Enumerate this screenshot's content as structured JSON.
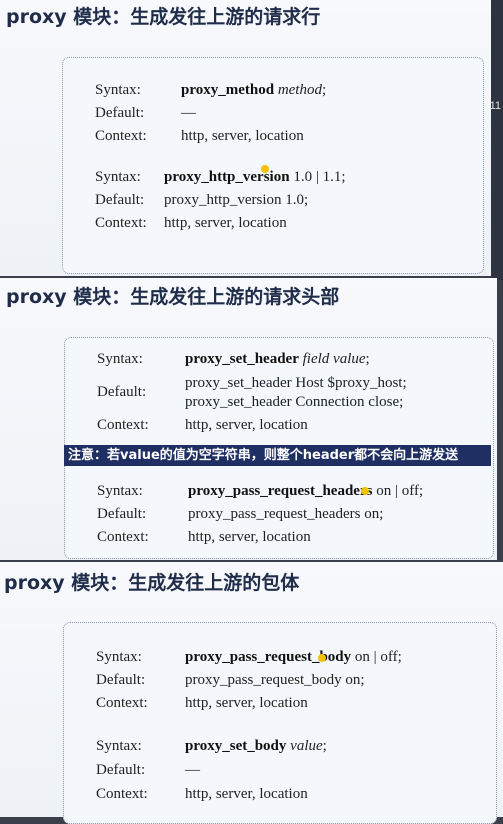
{
  "panel1": {
    "title": "proxy 模块：生成发往上游的请求行",
    "b1": {
      "syntax_label": "Syntax:",
      "syntax_cmd": "proxy_method",
      "syntax_arg": "method",
      "syntax_end": ";",
      "default_label": "Default:",
      "default_val": "—",
      "context_label": "Context:",
      "context_val": "http, server, location"
    },
    "b2": {
      "syntax_label": "Syntax:",
      "syntax_cmd": "proxy_http_version",
      "syntax_arg": " 1.0 | 1.1;",
      "default_label": "Default:",
      "default_val": "proxy_http_version 1.0;",
      "context_label": "Context:",
      "context_val": "http, server, location"
    }
  },
  "panel2": {
    "title": "proxy 模块：生成发往上游的请求头部",
    "b1": {
      "syntax_label": "Syntax:",
      "syntax_cmd": "proxy_set_header",
      "syntax_arg": "field value",
      "syntax_end": ";",
      "default_label": "Default:",
      "default_val1": "proxy_set_header Host $proxy_host;",
      "default_val2": "proxy_set_header Connection close;",
      "context_label": "Context:",
      "context_val": "http, server, location"
    },
    "note": "注意：若value的值为空字符串，则整个header都不会向上游发送",
    "b2": {
      "syntax_label": "Syntax:",
      "syntax_cmd": "proxy_pass_request_headers",
      "syntax_arg": " on | off;",
      "default_label": "Default:",
      "default_val": "proxy_pass_request_headers on;",
      "context_label": "Context:",
      "context_val": "http, server, location"
    }
  },
  "panel3": {
    "title": "proxy 模块：生成发往上游的包体",
    "b1": {
      "syntax_label": "Syntax:",
      "syntax_cmd": "proxy_pass_request_body",
      "syntax_arg": " on | off;",
      "default_label": "Default:",
      "default_val": "proxy_pass_request_body on;",
      "context_label": "Context:",
      "context_val": "http, server, location"
    },
    "b2": {
      "syntax_label": "Syntax:",
      "syntax_cmd": "proxy_set_body",
      "syntax_arg": "value",
      "syntax_end": ";",
      "default_label": "Default:",
      "default_val": "—",
      "context_label": "Context:",
      "context_val": "http, server, location"
    }
  },
  "edge": {
    "text": "11"
  },
  "colors": {
    "title": "#1f2d4a",
    "note_bg": "#1f2f63",
    "cursor_dot": "#f2c200"
  }
}
